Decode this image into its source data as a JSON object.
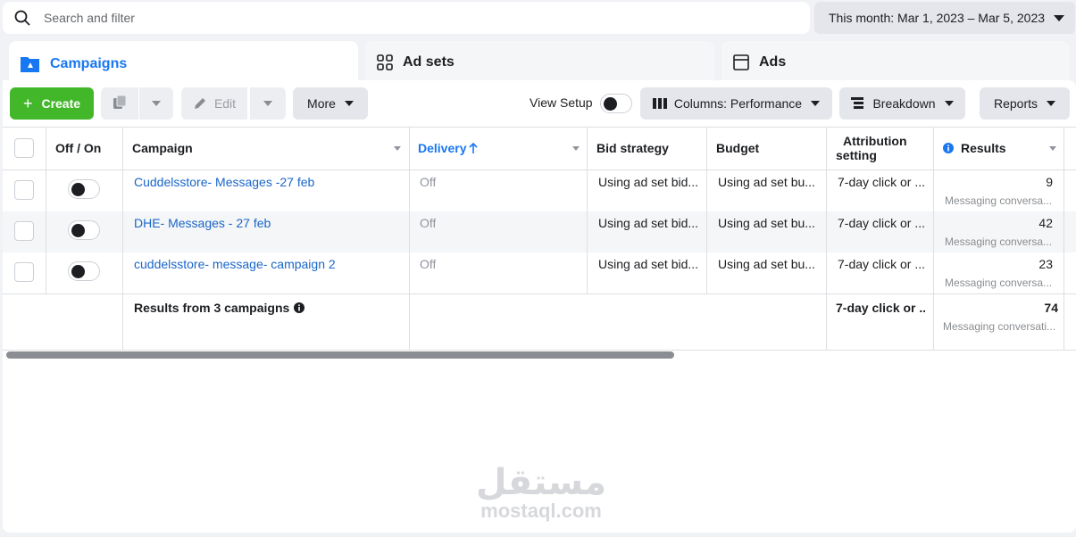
{
  "search": {
    "placeholder": "Search and filter"
  },
  "date_range": {
    "label": "This month: Mar 1, 2023 – Mar 5, 2023"
  },
  "tabs": [
    {
      "label": "Campaigns",
      "icon": "campaigns-folder-icon",
      "active": true
    },
    {
      "label": "Ad sets",
      "icon": "grid-icon",
      "active": false
    },
    {
      "label": "Ads",
      "icon": "ad-window-icon",
      "active": false
    }
  ],
  "toolbar": {
    "create_label": "Create",
    "edit_label": "Edit",
    "more_label": "More",
    "view_setup_label": "View Setup",
    "columns_label": "Columns: Performance",
    "breakdown_label": "Breakdown",
    "reports_label": "Reports"
  },
  "table": {
    "headers": {
      "off_on": "Off / On",
      "campaign": "Campaign",
      "delivery": "Delivery",
      "bid_strategy": "Bid strategy",
      "budget": "Budget",
      "attribution_1": "Attribution",
      "attribution_2": "setting",
      "results": "Results"
    },
    "rows": [
      {
        "campaign": "Cuddelsstore- Messages -27 feb",
        "delivery": "Off",
        "bid_strategy": "Using ad set bid...",
        "budget": "Using ad set bu...",
        "attribution": "7-day click or ...",
        "results": "9",
        "results_sub": "Messaging conversa..."
      },
      {
        "campaign": "DHE- Messages - 27 feb",
        "delivery": "Off",
        "bid_strategy": "Using ad set bid...",
        "budget": "Using ad set bu...",
        "attribution": "7-day click or ...",
        "results": "42",
        "results_sub": "Messaging conversa..."
      },
      {
        "campaign": "cuddelsstore- message- campaign 2",
        "delivery": "Off",
        "bid_strategy": "Using ad set bid...",
        "budget": "Using ad set bu...",
        "attribution": "7-day click or ...",
        "results": "23",
        "results_sub": "Messaging conversa..."
      }
    ],
    "footer": {
      "label": "Results from 3 campaigns",
      "attribution": "7-day click or ...",
      "results": "74",
      "results_sub": "Messaging conversati..."
    }
  },
  "watermark": {
    "arabic": "مستقل",
    "latin": "mostaql.com"
  },
  "colors": {
    "accent": "#1877f2",
    "create": "#42b72a",
    "link": "#1a66c8"
  }
}
